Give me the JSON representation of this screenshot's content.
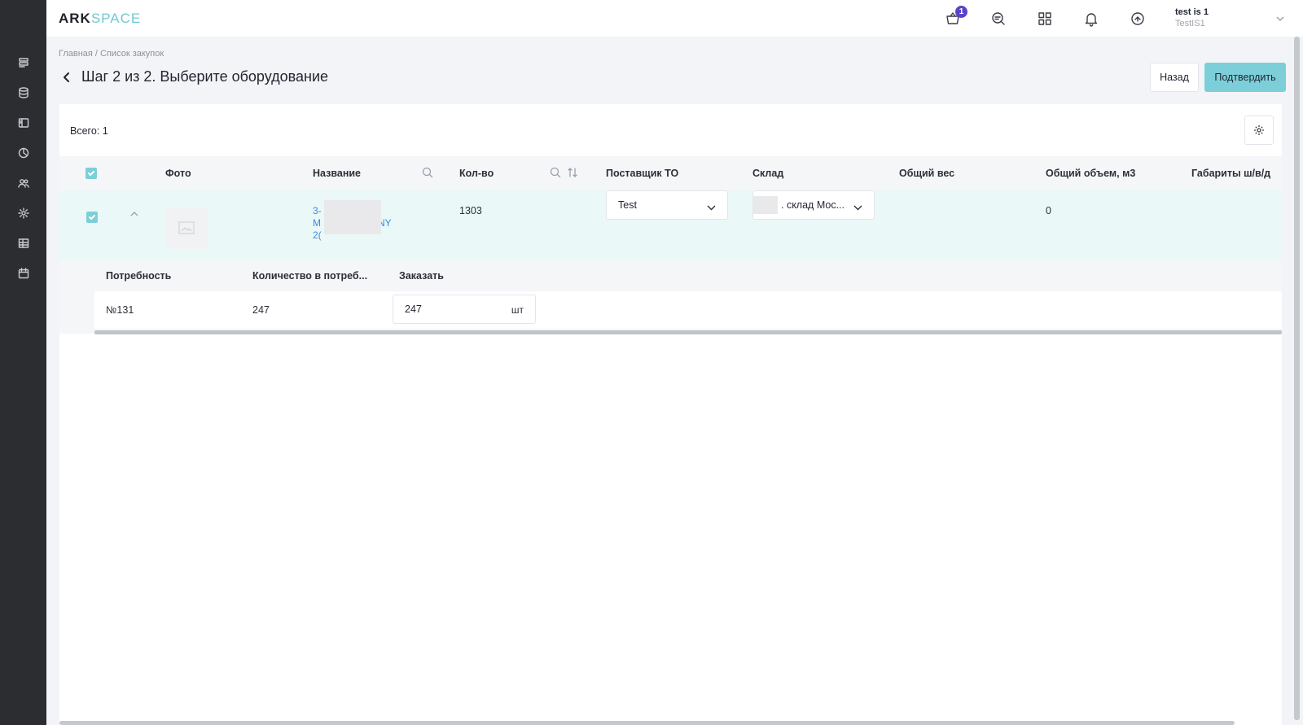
{
  "app": {
    "logo_part1": "ARK",
    "logo_part2": "SPACE",
    "accent_color": "#7ccfd8",
    "sidebar_bg": "#2b2d31"
  },
  "sidebar": {
    "items": [
      {
        "icon": "list-stack-icon"
      },
      {
        "icon": "database-icon"
      },
      {
        "icon": "sidebar-panel-icon"
      },
      {
        "icon": "pie-chart-icon"
      },
      {
        "icon": "users-icon"
      },
      {
        "icon": "gear-icon"
      },
      {
        "icon": "table-grid-icon"
      },
      {
        "icon": "calendar-icon"
      }
    ]
  },
  "header": {
    "cart_badge": "1",
    "icons": [
      "cart-icon",
      "chat-icon",
      "apps-grid-icon",
      "bell-icon",
      "sync-icon"
    ],
    "user_name": "test is 1",
    "user_org": "TestIS1"
  },
  "page": {
    "breadcrumb": "Главная / Список закупок",
    "title": "Шаг 2 из 2. Выберите оборудование",
    "back_button": "Назад",
    "confirm_button": "Подтвердить",
    "total_label": "Всего: 1"
  },
  "table": {
    "columns": [
      "Фото",
      "Название",
      "Кол-во",
      "Поставщик ТО",
      "Склад",
      "Общий вес",
      "Общий объем, м3",
      "Габариты ш/в/д"
    ],
    "row": {
      "name_line1": "3-",
      "name_line2": "M",
      "name_line2_end": "NY",
      "name_line3": "2(",
      "qty": "1303",
      "supplier": "Test",
      "warehouse": ". склад Мос...",
      "total_weight": "",
      "total_volume": "0",
      "dimensions": ""
    }
  },
  "subtable": {
    "columns": [
      "Потребность",
      "Количество в потреб...",
      "Заказать"
    ],
    "row": {
      "need": "№131",
      "qty_in_need": "247",
      "order_value": "247",
      "order_unit": "шт"
    }
  }
}
